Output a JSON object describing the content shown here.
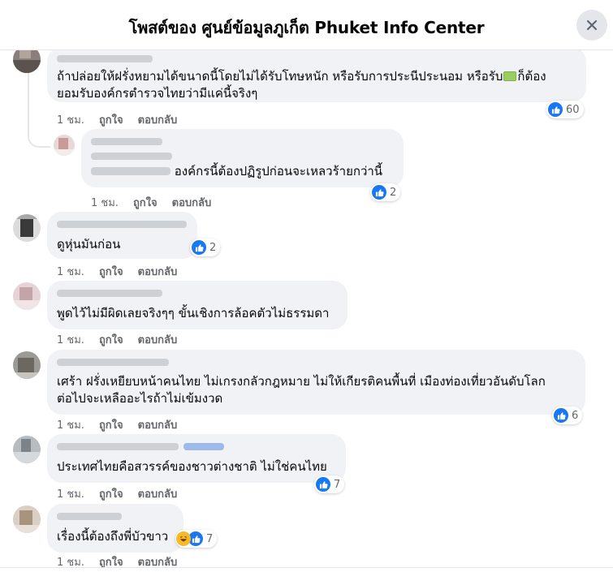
{
  "header": {
    "title": "โพสต์ของ ศูนย์ข้อมูลภูเก็ต Phuket Info Center"
  },
  "actions": {
    "like": "ถูกใจ",
    "reply": "ตอบกลับ"
  },
  "comments": [
    {
      "line1": "ถ้าปล่อยให้ฝรั่งหยามได้ขนาดนี้โดยไม่ได้รับโทษหนัก หรือรับการประนีประนอม หรือรับ",
      "line1_end": "ก็ต้อง",
      "line2": "ยอมรับองค์กรตำรวจไทยว่ามีแค่นี้จริงๆ",
      "time": "1 ชม.",
      "reactions": "60"
    },
    {
      "text": "องค์กรนี้ต้องปฏิรูปก่อนจะเหลวร้ายกว่านี้",
      "time": "1 ชม.",
      "reactions": "2"
    },
    {
      "text": "ดูหุ่นมันก่อน",
      "time": "1 ชม.",
      "reactions": "2"
    },
    {
      "text": "พูดไว้ไม่มีผิดเลยจริงๆๆ ขั้นเชิงการล้อคตัวไม่ธรรมดา",
      "time": "1 ชม."
    },
    {
      "line1": "เศร้า ฝรั่งเหยียบหน้าคนไทย ไม่เกรงกลัวกฎหมาย ไม่ให้เกียรติคนพื้นที่ เมืองท่องเที่ยวอันดับโลก",
      "line2": "ต่อไปจะเหลืออะไรถ้าไม่เข้มงวด",
      "time": "1 ชม.",
      "reactions": "6"
    },
    {
      "text": "ประเทศไทยคือสวรรค์ของชาวต่างชาติ ไม่ใช่คนไทย",
      "time": "1 ชม.",
      "reactions": "7"
    },
    {
      "text": "เรื่องนี้ต้องถึงพี่บัวขาว",
      "time": "1 ชม.",
      "reactions": "7"
    }
  ],
  "colors": {
    "like_blue": "#1877f2",
    "bubble": "#f0f2f5",
    "meta": "#65676b"
  },
  "icons": {
    "close": "close-icon",
    "like": "like-icon",
    "haha": "haha-icon",
    "money": "money-emoji"
  }
}
